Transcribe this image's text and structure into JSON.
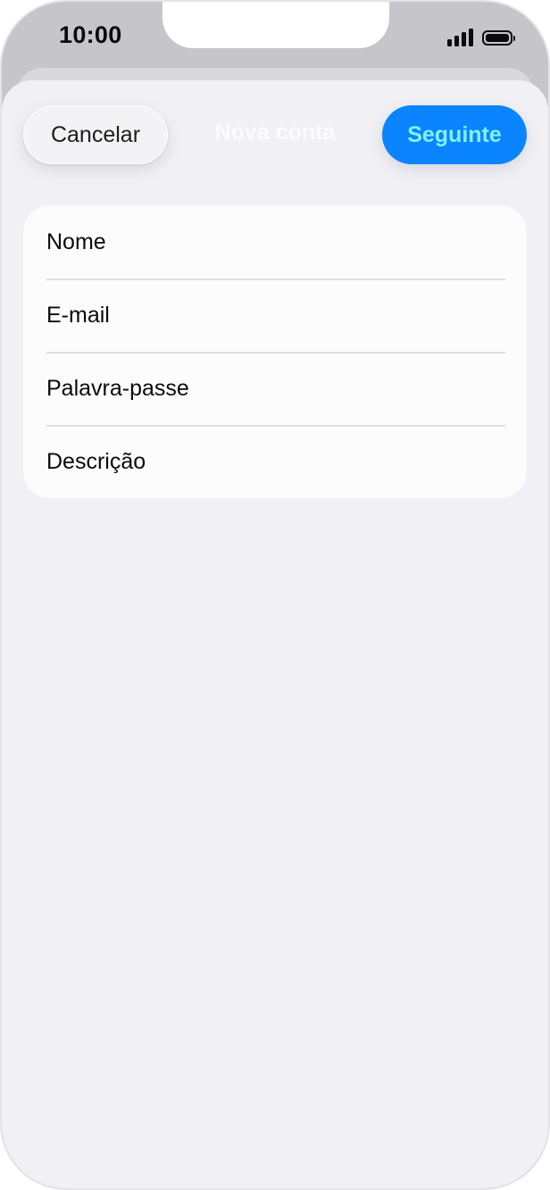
{
  "status_bar": {
    "time": "10:00",
    "signal_icon": "signal-bars-icon",
    "battery_icon": "battery-full-icon",
    "battery_level": 1.0
  },
  "nav": {
    "cancel_label": "Cancelar",
    "title": "Nova conta",
    "next_label": "Seguinte"
  },
  "form": {
    "fields": [
      {
        "placeholder": "Nome",
        "value": ""
      },
      {
        "placeholder": "E-mail",
        "value": ""
      },
      {
        "placeholder": "Palavra-passe",
        "value": ""
      },
      {
        "placeholder": "Descrição",
        "value": ""
      }
    ]
  },
  "colors": {
    "accent": "#0a84ff",
    "accent_text": "#7ff2ff",
    "sheet_background": "#f0f0f5",
    "card_background": "#fcfcfd"
  }
}
